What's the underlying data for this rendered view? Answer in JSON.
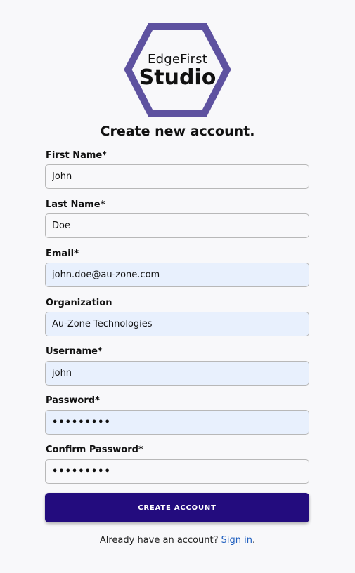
{
  "logo": {
    "line1": "EdgeFirst",
    "line2": "Studio",
    "hex_color": "#5e52a0"
  },
  "title": "Create new account.",
  "fields": [
    {
      "label": "First Name",
      "required": "*",
      "value": "John",
      "type": "text"
    },
    {
      "label": "Last Name",
      "required": "*",
      "value": "Doe",
      "type": "text"
    },
    {
      "label": "Email",
      "required": "*",
      "value": "john.doe@au-zone.com",
      "type": "email"
    },
    {
      "label": "Organization",
      "required": "",
      "value": "Au-Zone Technologies",
      "type": "text"
    },
    {
      "label": "Username",
      "required": "*",
      "value": "john",
      "type": "text"
    },
    {
      "label": "Password",
      "required": "*",
      "value": "•••••••••",
      "type": "password"
    },
    {
      "label": "Confirm Password",
      "required": "*",
      "value": "•••••••••",
      "type": "password"
    }
  ],
  "submit_label": "CREATE ACCOUNT",
  "footer": {
    "text": "Already have an account? ",
    "link": "Sign in",
    "suffix": "."
  },
  "colors": {
    "button": "#230c7e",
    "link": "#1f5fbf",
    "autofill": "#e8f0fd"
  }
}
